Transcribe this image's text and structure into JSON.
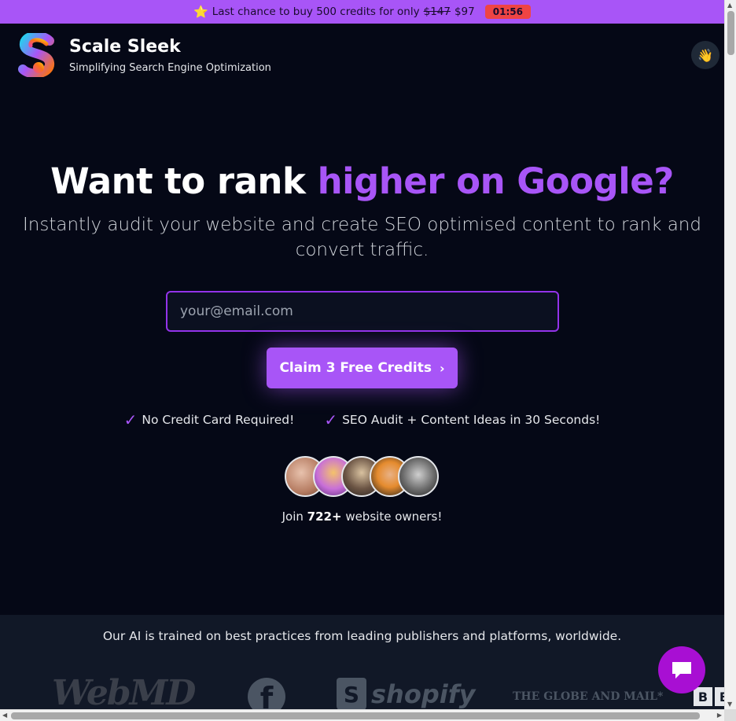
{
  "promo": {
    "star": "⭐",
    "text": "Last chance to buy 500 credits for only",
    "old_price": "$147",
    "new_price": "$97",
    "timer": "01:56"
  },
  "header": {
    "brand_name": "Scale Sleek",
    "tagline": "Simplifying Search Engine Optimization",
    "wave_icon": "👋"
  },
  "hero": {
    "title_plain": "Want to rank ",
    "title_accent": "higher on Google?",
    "subtitle": "Instantly audit your website and create SEO optimised content to rank and convert traffic.",
    "email_placeholder": "your@email.com",
    "email_value": "",
    "cta_label": "Claim 3 Free Credits",
    "cta_chevron": "›",
    "checks": [
      {
        "tick": "✓",
        "label": "No Credit Card Required!"
      },
      {
        "tick": "✓",
        "label": "SEO Audit + Content Ideas in 30 Seconds!"
      }
    ],
    "join_prefix": "Join ",
    "join_count": "722+",
    "join_suffix": " website owners!"
  },
  "avatars": [
    "#c9a08a",
    "#d4a24c",
    "#8a6a4f",
    "#e58b2e",
    "#9a9a9a"
  ],
  "publishers": {
    "text": "Our AI is trained on best practices from leading publishers and platforms, worldwide.",
    "webmd": "WebMD",
    "facebook": "f",
    "shopify_bag": "S",
    "shopify": "shopify",
    "globe": "THE GLOBE AND MAIL*",
    "bbc": [
      "B",
      "B"
    ]
  },
  "colors": {
    "accent": "#a855f7",
    "background": "#050816",
    "promo_bar": "#a855f7",
    "timer": "#ef4444",
    "chat": "#a80fd3"
  }
}
